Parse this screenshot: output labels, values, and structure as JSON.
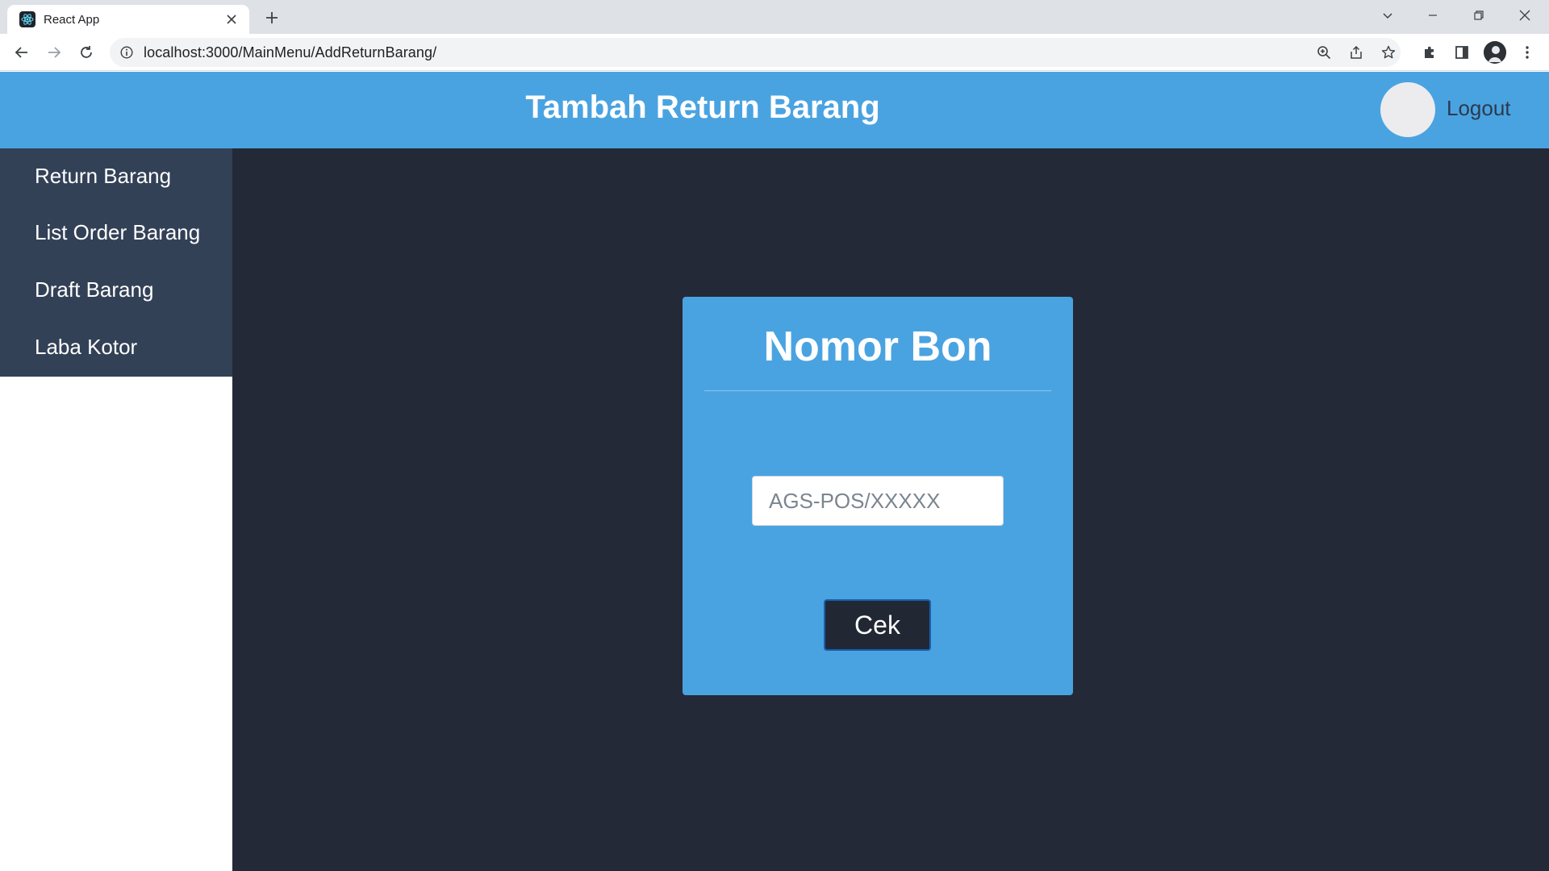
{
  "browser": {
    "tab_title": "React App",
    "url": "localhost:3000/MainMenu/AddReturnBarang/",
    "icons": {
      "favicon": "react-logo-icon",
      "tab_close": "close-icon",
      "new_tab": "plus-icon",
      "back": "arrow-left-icon",
      "forward": "arrow-right-icon",
      "reload": "reload-icon",
      "site_info": "info-icon",
      "zoom": "zoom-icon",
      "share": "share-icon",
      "bookmark": "star-icon",
      "extensions": "puzzle-icon",
      "side_panel": "side-panel-icon",
      "profile": "avatar-icon",
      "menu": "kebab-menu-icon",
      "tab_search": "chevron-down-icon",
      "minimize": "minimize-icon",
      "restore": "restore-icon",
      "close_window": "close-icon"
    }
  },
  "header": {
    "title": "Tambah Return Barang",
    "logout_label": "Logout"
  },
  "sidebar": {
    "items": [
      {
        "label": "Return Barang"
      },
      {
        "label": "List Order Barang"
      },
      {
        "label": "Draft Barang"
      },
      {
        "label": "Laba Kotor"
      }
    ]
  },
  "form": {
    "title": "Nomor Bon",
    "input_placeholder": "AGS-POS/XXXXX",
    "input_value": "",
    "submit_label": "Cek"
  },
  "colors": {
    "header_bg": "#4aa3e1",
    "sidebar_bg": "#334157",
    "main_bg": "#232936",
    "card_bg": "#4aa3e1",
    "button_bg": "#222833",
    "button_border": "#1a5fb0"
  }
}
